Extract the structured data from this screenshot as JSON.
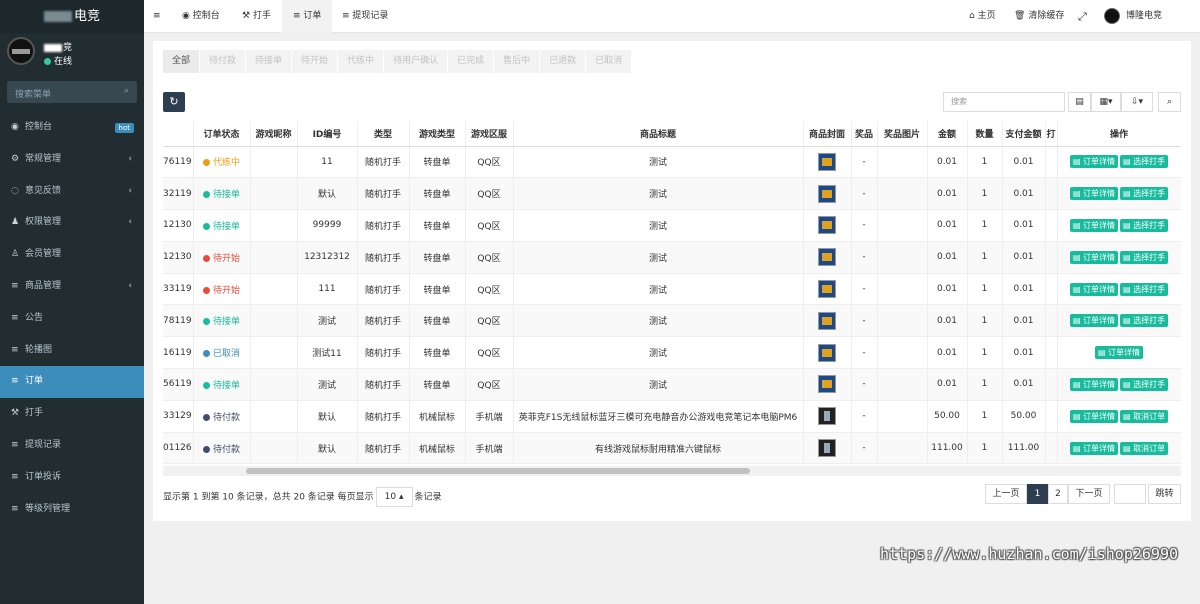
{
  "sidebar": {
    "logo": "电竞",
    "user": {
      "name": "竞",
      "status": "在线"
    },
    "search_placeholder": "搜索菜单",
    "items": [
      {
        "icon": "dashboard-icon",
        "glyph": "◉",
        "label": "控制台",
        "badge": "hot"
      },
      {
        "icon": "gears-icon",
        "glyph": "⚙",
        "label": "常规管理",
        "arrow": "‹"
      },
      {
        "icon": "comment-icon",
        "glyph": "◌",
        "label": "意见反馈",
        "arrow": "‹"
      },
      {
        "icon": "group-icon",
        "glyph": "♟",
        "label": "权限管理",
        "arrow": "‹"
      },
      {
        "icon": "user-icon",
        "glyph": "♙",
        "label": "会员管理"
      },
      {
        "icon": "list-icon",
        "glyph": "≡",
        "label": "商品管理",
        "arrow": "‹"
      },
      {
        "icon": "list-icon",
        "glyph": "≡",
        "label": "公告"
      },
      {
        "icon": "list-icon",
        "glyph": "≡",
        "label": "轮播图"
      },
      {
        "icon": "list-icon",
        "glyph": "≡",
        "label": "订单"
      },
      {
        "icon": "hammer-icon",
        "glyph": "⚒",
        "label": "打手"
      },
      {
        "icon": "list-icon",
        "glyph": "≡",
        "label": "提现记录"
      },
      {
        "icon": "list-icon",
        "glyph": "≡",
        "label": "订单投诉"
      },
      {
        "icon": "list-icon",
        "glyph": "≡",
        "label": "等级列管理"
      }
    ]
  },
  "topbar": {
    "menu_glyph": "≡",
    "tabs": [
      {
        "glyph": "◉",
        "label": "控制台"
      },
      {
        "glyph": "⚒",
        "label": "打手"
      },
      {
        "glyph": "≡",
        "label": "订单"
      },
      {
        "glyph": "≡",
        "label": "提现记录"
      }
    ],
    "home": "主页",
    "clear_cache": "清除缓存",
    "fullscreen_glyph": "⤢",
    "user_name": "博隆电竞"
  },
  "status_tabs": [
    "全部",
    "待付款",
    "待接单",
    "待开始",
    "代练中",
    "待用户确认",
    "已完成",
    "售后中",
    "已退款",
    "已取消"
  ],
  "toolbar": {
    "refresh_glyph": "↻",
    "search_placeholder": "搜索",
    "btn_toggle": "▤",
    "btn_columns": "▦▾",
    "btn_export": "⇩▾",
    "btn_search": "⌕"
  },
  "table": {
    "headers": [
      "",
      "订单状态",
      "游戏昵称",
      "ID编号",
      "类型",
      "游戏类型",
      "游戏区服",
      "商品标题",
      "商品封面",
      "奖品",
      "奖品图片",
      "金额",
      "数量",
      "支付金额",
      "打",
      "操作"
    ],
    "rows": [
      {
        "id": "76119",
        "status": "代练中",
        "status_color": "#f39c12",
        "nick": "",
        "idno": "11",
        "type": "随机打手",
        "gtype": "转盘单",
        "zone": "QQ区",
        "title": "测试",
        "cover": "game",
        "prize": "-",
        "amount": "0.01",
        "qty": "1",
        "paid": "0.01",
        "actions": [
          "订单详情",
          "选择打手"
        ]
      },
      {
        "id": "32119",
        "status": "待接单",
        "status_color": "#18bc9c",
        "nick": "",
        "idno": "默认",
        "type": "随机打手",
        "gtype": "转盘单",
        "zone": "QQ区",
        "title": "测试",
        "cover": "game",
        "prize": "-",
        "amount": "0.01",
        "qty": "1",
        "paid": "0.01",
        "actions": [
          "订单详情",
          "选择打手"
        ]
      },
      {
        "id": "12130",
        "status": "待接单",
        "status_color": "#18bc9c",
        "nick": "",
        "idno": "99999",
        "type": "随机打手",
        "gtype": "转盘单",
        "zone": "QQ区",
        "title": "测试",
        "cover": "game",
        "prize": "-",
        "amount": "0.01",
        "qty": "1",
        "paid": "0.01",
        "actions": [
          "订单详情",
          "选择打手"
        ]
      },
      {
        "id": "12130",
        "status": "待开始",
        "status_color": "#e74c3c",
        "nick": "",
        "idno": "12312312",
        "type": "随机打手",
        "gtype": "转盘单",
        "zone": "QQ区",
        "title": "测试",
        "cover": "game",
        "prize": "-",
        "amount": "0.01",
        "qty": "1",
        "paid": "0.01",
        "actions": [
          "订单详情",
          "选择打手"
        ]
      },
      {
        "id": "33119",
        "status": "待开始",
        "status_color": "#e74c3c",
        "nick": "",
        "idno": "111",
        "type": "随机打手",
        "gtype": "转盘单",
        "zone": "QQ区",
        "title": "测试",
        "cover": "game",
        "prize": "-",
        "amount": "0.01",
        "qty": "1",
        "paid": "0.01",
        "actions": [
          "订单详情",
          "选择打手"
        ]
      },
      {
        "id": "78119",
        "status": "待接单",
        "status_color": "#18bc9c",
        "nick": "",
        "idno": "测试",
        "type": "随机打手",
        "gtype": "转盘单",
        "zone": "QQ区",
        "title": "测试",
        "cover": "game",
        "prize": "-",
        "amount": "0.01",
        "qty": "1",
        "paid": "0.01",
        "actions": [
          "订单详情",
          "选择打手"
        ]
      },
      {
        "id": "16119",
        "status": "已取消",
        "status_color": "#3c8dbc",
        "nick": "",
        "idno": "测试11",
        "type": "随机打手",
        "gtype": "转盘单",
        "zone": "QQ区",
        "title": "测试",
        "cover": "game",
        "prize": "-",
        "amount": "0.01",
        "qty": "1",
        "paid": "0.01",
        "actions": [
          "订单详情"
        ]
      },
      {
        "id": "56119",
        "status": "待接单",
        "status_color": "#18bc9c",
        "nick": "",
        "idno": "测试",
        "type": "随机打手",
        "gtype": "转盘单",
        "zone": "QQ区",
        "title": "测试",
        "cover": "game",
        "prize": "-",
        "amount": "0.01",
        "qty": "1",
        "paid": "0.01",
        "actions": [
          "订单详情",
          "选择打手"
        ]
      },
      {
        "id": "33129",
        "status": "待付款",
        "status_color": "#444c6e",
        "nick": "",
        "idno": "默认",
        "type": "随机打手",
        "gtype": "机械鼠标",
        "zone": "手机端",
        "title": "英菲克F1S无线鼠标蓝牙三模可充电静音办公游戏电竞笔记本电脑PM6",
        "cover": "mouse",
        "prize": "-",
        "amount": "50.00",
        "qty": "1",
        "paid": "50.00",
        "actions": [
          "订单详情",
          "取消订单"
        ]
      },
      {
        "id": "01126",
        "status": "待付款",
        "status_color": "#444c6e",
        "nick": "",
        "idno": "默认",
        "type": "随机打手",
        "gtype": "机械鼠标",
        "zone": "手机端",
        "title": "有线游戏鼠标耐用精准六键鼠标",
        "cover": "mouse",
        "prize": "-",
        "amount": "111.00",
        "qty": "1",
        "paid": "111.00",
        "actions": [
          "订单详情",
          "取消订单"
        ]
      }
    ]
  },
  "footer": {
    "info_prefix": "显示第 1 到第 10 条记录，总共 20 条记录 每页显示",
    "page_size": "10",
    "info_suffix": "条记录",
    "prev": "上一页",
    "pages": [
      "1",
      "2"
    ],
    "next": "下一页",
    "jump": "跳转"
  },
  "watermark": "https://www.huzhan.com/ishop26990"
}
